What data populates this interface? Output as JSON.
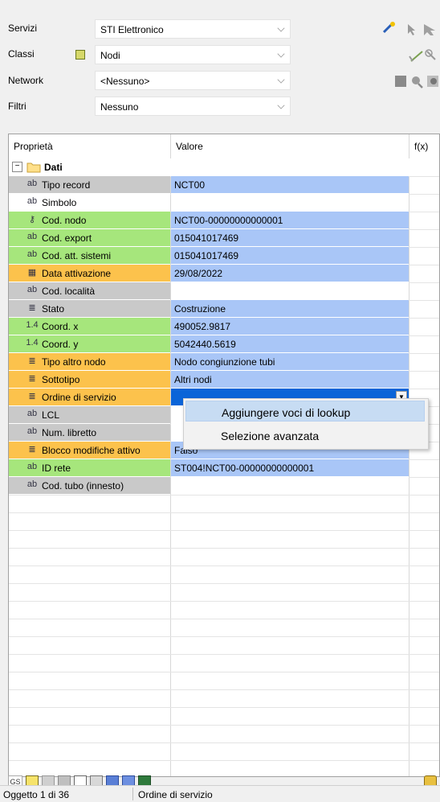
{
  "filters": [
    {
      "label": "Servizi",
      "value": "STI Elettronico"
    },
    {
      "label": "Classi",
      "value": "Nodi"
    },
    {
      "label": "Network",
      "value": "<Nessuno>"
    },
    {
      "label": "Filtri",
      "value": "Nessuno"
    }
  ],
  "grid": {
    "headers": {
      "property": "Proprietà",
      "value": "Valore",
      "fx": "f(x)"
    },
    "group": {
      "toggle": "⊟",
      "label": "Dati"
    },
    "rows": [
      {
        "icon": "ab",
        "label": "Tipo record",
        "value": "NCT00"
      },
      {
        "icon": "ab",
        "label": "Simbolo",
        "value": ""
      },
      {
        "icon": "key",
        "label": "Cod. nodo",
        "value": "NCT00-00000000000001"
      },
      {
        "icon": "ab",
        "label": "Cod. export",
        "value": "015041017469"
      },
      {
        "icon": "ab",
        "label": "Cod. att. sistemi",
        "value": "015041017469"
      },
      {
        "icon": "calendar",
        "label": "Data attivazione",
        "value": "29/08/2022"
      },
      {
        "icon": "ab",
        "label": "Cod. località",
        "value": ""
      },
      {
        "icon": "list",
        "label": "Stato",
        "value": "Costruzione"
      },
      {
        "icon": "1.4",
        "label": "Coord. x",
        "value": "490052.9817"
      },
      {
        "icon": "1.4",
        "label": "Coord. y",
        "value": "5042440.5619"
      },
      {
        "icon": "list",
        "label": "Tipo altro nodo",
        "value": "Nodo congiunzione tubi"
      },
      {
        "icon": "list",
        "label": "Sottotipo",
        "value": "Altri nodi"
      },
      {
        "icon": "list",
        "label": "Ordine di servizio",
        "value": ""
      },
      {
        "icon": "ab",
        "label": "LCL",
        "value": ""
      },
      {
        "icon": "ab",
        "label": "Num. libretto",
        "value": ""
      },
      {
        "icon": "list",
        "label": "Blocco modifiche attivo",
        "value": "Falso"
      },
      {
        "icon": "ab",
        "label": "ID rete",
        "value": "ST004!NCT00-00000000000001"
      },
      {
        "icon": "ab",
        "label": "Cod. tubo (innesto)",
        "value": ""
      }
    ]
  },
  "context_menu": {
    "items": [
      "Aggiungere voci di lookup",
      "Selezione avanzata"
    ]
  },
  "bottom_toolbar": {
    "gs_label": "GS"
  },
  "status_bar": {
    "object_counter": "Oggetto 1 di 36",
    "current_field": "Ordine di servizio"
  },
  "colors": {
    "gray": "#c9c9c9",
    "green": "#a6e67c",
    "orange": "#fcc24c",
    "blue": "#a9c6f7",
    "selected": "#0a64d8",
    "highlight": "#c7dcf3"
  }
}
